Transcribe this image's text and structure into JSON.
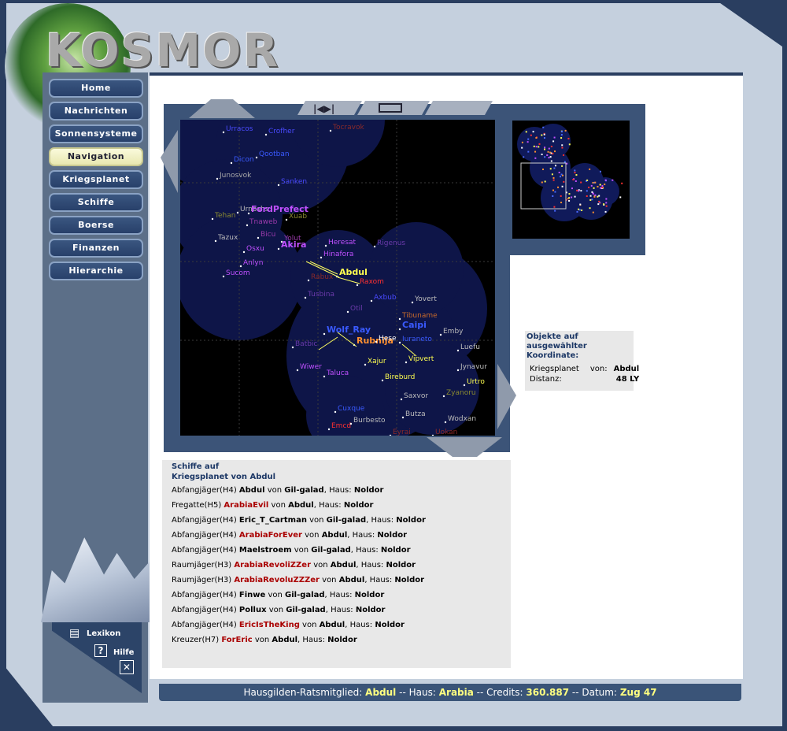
{
  "logo": {
    "text": "KOSMOR"
  },
  "nav": [
    {
      "label": "Home"
    },
    {
      "label": "Nachrichten"
    },
    {
      "label": "Sonnensysteme"
    },
    {
      "label": "Navigation",
      "active": true
    },
    {
      "label": "Kriegsplanet"
    },
    {
      "label": "Schiffe"
    },
    {
      "label": "Boerse"
    },
    {
      "label": "Finanzen"
    },
    {
      "label": "Hierarchie"
    }
  ],
  "help": {
    "lexikon": "Lexikon",
    "hilfe": "Hilfe"
  },
  "map": {
    "labels": [
      {
        "t": "Urracos",
        "c": "#4a4aff"
      },
      {
        "t": "Crofher",
        "c": "#4a4aff"
      },
      {
        "t": "Tocravok",
        "c": "#8a2a2a"
      },
      {
        "t": "Qootban",
        "c": "#3a5aff"
      },
      {
        "t": "Dicon",
        "c": "#3a5aff"
      },
      {
        "t": "Junosvok",
        "c": "#aaaaaa"
      },
      {
        "t": "Sanken",
        "c": "#4a4aff"
      },
      {
        "t": "Urnoshs",
        "c": "#bbbbbb"
      },
      {
        "t": "Tehan",
        "c": "#8a8a30"
      },
      {
        "t": "FordPrefect",
        "c": "#c050ff"
      },
      {
        "t": "Xuab",
        "c": "#8a8a30"
      },
      {
        "t": "Tnaweb",
        "c": "#9a3aaa"
      },
      {
        "t": "Tazux",
        "c": "#bbbbbb"
      },
      {
        "t": "Bicu",
        "c": "#9a3aaa"
      },
      {
        "t": "Yolut",
        "c": "#9a3aaa"
      },
      {
        "t": "Osxu",
        "c": "#c050ff"
      },
      {
        "t": "Akira",
        "c": "#c050ff"
      },
      {
        "t": "Heresat",
        "c": "#c050ff"
      },
      {
        "t": "Rigenus",
        "c": "#6a3aaa"
      },
      {
        "t": "Hinafora",
        "c": "#c050ff"
      },
      {
        "t": "Anlyn",
        "c": "#c050ff"
      },
      {
        "t": "Sucom",
        "c": "#c050ff"
      },
      {
        "t": "Abdul",
        "c": "#ffff50"
      },
      {
        "t": "Raxom",
        "c": "#ff3030"
      },
      {
        "t": "Rabux",
        "c": "#8a2a2a"
      },
      {
        "t": "Tusbina",
        "c": "#6a3aaa"
      },
      {
        "t": "Otil",
        "c": "#6a3aaa"
      },
      {
        "t": "Axbub",
        "c": "#4a4aff"
      },
      {
        "t": "Yovert",
        "c": "#bbbbbb"
      },
      {
        "t": "Tibuname",
        "c": "#c86a2a"
      },
      {
        "t": "Wolf_Ray",
        "c": "#3a5aff"
      },
      {
        "t": "Caipi",
        "c": "#3a5aff"
      },
      {
        "t": "Emby",
        "c": "#bbbbbb"
      },
      {
        "t": "Batbic",
        "c": "#6a3aaa"
      },
      {
        "t": "Rubnija",
        "c": "#ff9030"
      },
      {
        "t": "Hese",
        "c": "#ffffff"
      },
      {
        "t": "Iuraneto",
        "c": "#3a5aff"
      },
      {
        "t": "Luefu",
        "c": "#bbbbbb"
      },
      {
        "t": "Wiwer",
        "c": "#c050ff"
      },
      {
        "t": "Xajur",
        "c": "#ffff50"
      },
      {
        "t": "Vipvert",
        "c": "#ffff50"
      },
      {
        "t": "Jynavur",
        "c": "#bbbbbb"
      },
      {
        "t": "Taluca",
        "c": "#c050ff"
      },
      {
        "t": "Bireburd",
        "c": "#ffff50"
      },
      {
        "t": "Urtro",
        "c": "#ffff50"
      },
      {
        "t": "Saxvor",
        "c": "#bbbbbb"
      },
      {
        "t": "Zyanoru",
        "c": "#8a8a30"
      },
      {
        "t": "Cuxque",
        "c": "#3a5aff"
      },
      {
        "t": "Butza",
        "c": "#bbbbbb"
      },
      {
        "t": "Wodxan",
        "c": "#bbbbbb"
      },
      {
        "t": "Emcd",
        "c": "#ff3030"
      },
      {
        "t": "Burbesto",
        "c": "#bbbbbb"
      },
      {
        "t": "Eyrai",
        "c": "#8a2a2a"
      },
      {
        "t": "Uokan",
        "c": "#8a2a2a"
      }
    ]
  },
  "objects": {
    "title1": "Objekte auf",
    "title2": "ausgewählter Koordinate:",
    "row1": {
      "type": "Kriegsplanet",
      "von": "von:",
      "owner": "Abdul"
    },
    "row2": {
      "label": "Distanz:",
      "value": "48 LY"
    }
  },
  "ships": {
    "title1": "Schiffe auf",
    "title2": "Kriegsplanet von Abdul",
    "rows": [
      {
        "cls": "Abfangjäger(H4)",
        "name": "Abdul",
        "red": false,
        "owner": "Gil-galad",
        "house": "Noldor"
      },
      {
        "cls": "Fregatte(H5)",
        "name": "ArabiaEvil",
        "red": true,
        "owner": "Abdul",
        "house": "Noldor"
      },
      {
        "cls": "Abfangjäger(H4)",
        "name": "Eric_T_Cartman",
        "red": false,
        "owner": "Gil-galad",
        "house": "Noldor"
      },
      {
        "cls": "Abfangjäger(H4)",
        "name": "ArabiaForEver",
        "red": true,
        "owner": "Abdul",
        "house": "Noldor"
      },
      {
        "cls": "Abfangjäger(H4)",
        "name": "Maelstroem",
        "red": false,
        "owner": "Gil-galad",
        "house": "Noldor"
      },
      {
        "cls": "Raumjäger(H3)",
        "name": "ArabiaRevoliZZer",
        "red": true,
        "owner": "Abdul",
        "house": "Noldor"
      },
      {
        "cls": "Raumjäger(H3)",
        "name": "ArabiaRevoluZZZer",
        "red": true,
        "owner": "Abdul",
        "house": "Noldor"
      },
      {
        "cls": "Abfangjäger(H4)",
        "name": "Finwe",
        "red": false,
        "owner": "Gil-galad",
        "house": "Noldor"
      },
      {
        "cls": "Abfangjäger(H4)",
        "name": "Pollux",
        "red": false,
        "owner": "Gil-galad",
        "house": "Noldor"
      },
      {
        "cls": "Abfangjäger(H4)",
        "name": "EricIsTheKing",
        "red": true,
        "owner": "Abdul",
        "house": "Noldor"
      },
      {
        "cls": "Kreuzer(H7)",
        "name": "ForEric",
        "red": true,
        "owner": "Abdul",
        "house": "Noldor"
      }
    ],
    "von": "von",
    "haus": "Haus:"
  },
  "status": {
    "role": "Hausgilden-Ratsmitglied:",
    "player": "Abdul",
    "house_label": "Haus:",
    "house": "Arabia",
    "credits_label": "Credits:",
    "credits": "360.887",
    "date_label": "Datum:",
    "date": "Zug 47",
    "sep": "--"
  }
}
